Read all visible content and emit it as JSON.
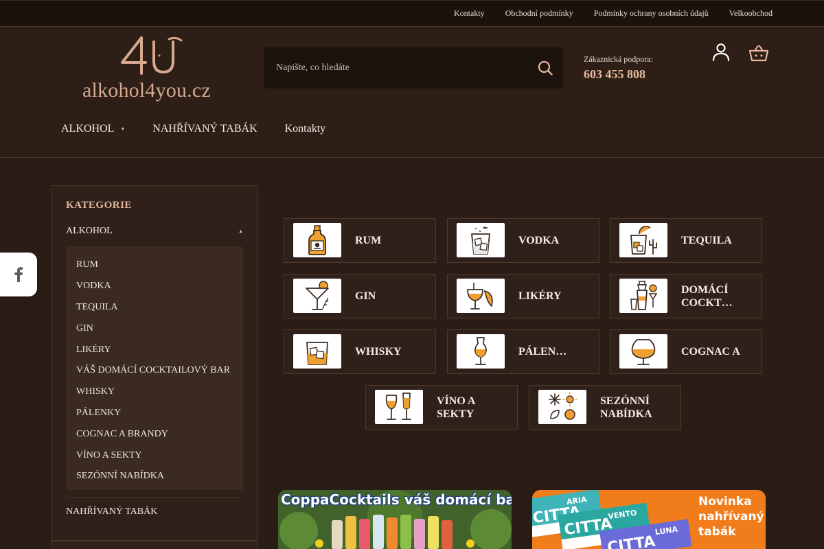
{
  "topbar": {
    "links": [
      "Kontakty",
      "Obchodní podmínky",
      "Podmínky ochrany osobních údajů",
      "Velkoobchod"
    ]
  },
  "header": {
    "logo_text": "alkohol4you.cz",
    "logo_mark": "4U",
    "search_placeholder": "Napište, co hledáte",
    "support_label": "Zákaznická podpora:",
    "support_phone": "603 455 808",
    "icons": {
      "search": "search-icon",
      "user": "user-icon",
      "cart": "basket-icon"
    }
  },
  "nav": {
    "items": [
      {
        "label": "ALKOHOL",
        "dropdown": true
      },
      {
        "label": "NAHŘÍVANÝ TABÁK"
      },
      {
        "label": "Kontakty"
      }
    ]
  },
  "sidebar": {
    "title": "KATEGORIE",
    "alkohol_label": "ALKOHOL",
    "subcategories": [
      "RUM",
      "VODKA",
      "TEQUILA",
      "GIN",
      "LIKÉRY",
      "VÁŠ DOMÁCÍ COCKTAILOVÝ BAR",
      "WHISKY",
      "PÁLENKY",
      "COGNAC A BRANDY",
      "VÍNO A SEKTY",
      "SEZÓNNÍ NABÍDKA"
    ],
    "tabak_label": "NAHŘÍVANÝ TABÁK"
  },
  "social": {
    "icon": "facebook-icon"
  },
  "categories": [
    {
      "label": "RUM",
      "icon": "rum-bottle-icon"
    },
    {
      "label": "VODKA",
      "icon": "vodka-glass-icon"
    },
    {
      "label": "TEQUILA",
      "icon": "tequila-icon"
    },
    {
      "label": "GIN",
      "icon": "gin-cocktail-icon"
    },
    {
      "label": "LIKÉRY",
      "icon": "liqueur-icon"
    },
    {
      "label": "DOMÁCÍ COCKT…",
      "icon": "cocktail-shaker-icon"
    },
    {
      "label": "WHISKY",
      "icon": "whisky-glass-icon"
    },
    {
      "label": "PÁLEN…",
      "icon": "palenka-glass-icon"
    },
    {
      "label": "COGNAC A",
      "icon": "cognac-glass-icon"
    },
    {
      "label": "VÍNO A SEKTY",
      "icon": "wine-glasses-icon"
    },
    {
      "label": "SEZÓNNÍ NABÍDKA",
      "icon": "seasons-icon"
    }
  ],
  "banners": {
    "coppa_title": "CoppaCocktails váš domácí bar",
    "citta_brand": "CITTA",
    "citta_flavors": [
      "ARIA",
      "VENTO",
      "LUNA"
    ],
    "citta_headline": [
      "Novinka",
      "nahřívaný",
      "tabák"
    ]
  },
  "colors": {
    "background": "#2a1d15",
    "accent": "#e7b89f",
    "icon_orange": "#f0a030"
  }
}
